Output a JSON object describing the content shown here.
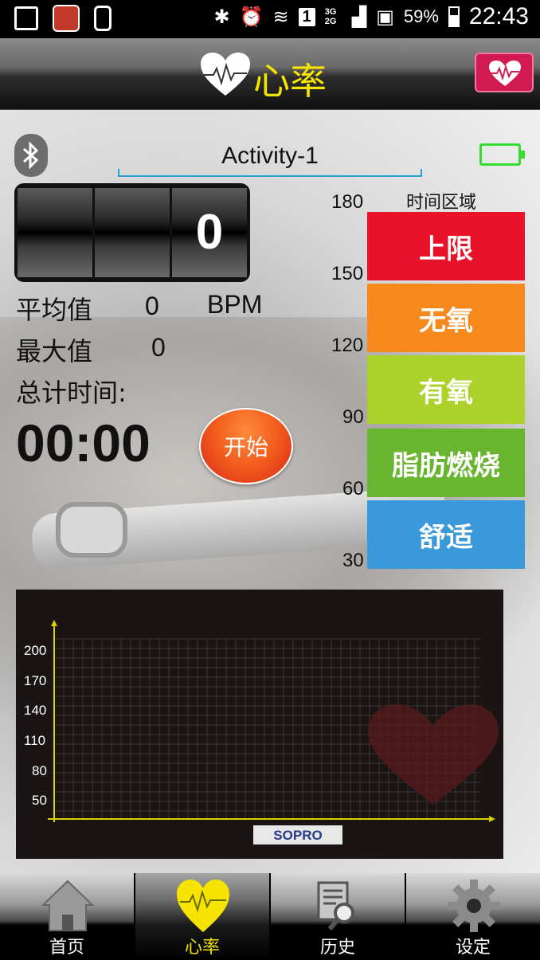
{
  "status_bar": {
    "signal": "3G 2G",
    "sim": "1",
    "battery": "59%",
    "time": "22:43"
  },
  "header": {
    "title": "心率"
  },
  "device": {
    "activity_name": "Activity-1"
  },
  "counter": {
    "digits": [
      "",
      "",
      "0"
    ]
  },
  "stats": {
    "avg_label": "平均值",
    "avg_value": "0",
    "unit": "BPM",
    "max_label": "最大值",
    "max_value": "0",
    "total_time_label": "总计时间:",
    "timer": "00:00",
    "start_label": "开始"
  },
  "zones": {
    "title": "时间区域",
    "scale": [
      "180",
      "150",
      "120",
      "90",
      "60",
      "30"
    ],
    "items": [
      {
        "label": "上限",
        "color": "#e8132a"
      },
      {
        "label": "无氧",
        "color": "#f5891c"
      },
      {
        "label": "有氧",
        "color": "#acd12b"
      },
      {
        "label": "脂肪燃烧",
        "color": "#68b52f"
      },
      {
        "label": "舒适",
        "color": "#3a9ad9"
      }
    ]
  },
  "graph": {
    "y_labels": [
      "200",
      "170",
      "140",
      "110",
      "80",
      "50"
    ],
    "logo": "SOPRO"
  },
  "nav": {
    "tabs": [
      {
        "label": "首页",
        "icon": "home-icon"
      },
      {
        "label": "心率",
        "icon": "heart-icon"
      },
      {
        "label": "历史",
        "icon": "history-icon"
      },
      {
        "label": "设定",
        "icon": "gear-icon"
      }
    ],
    "active": 1
  }
}
